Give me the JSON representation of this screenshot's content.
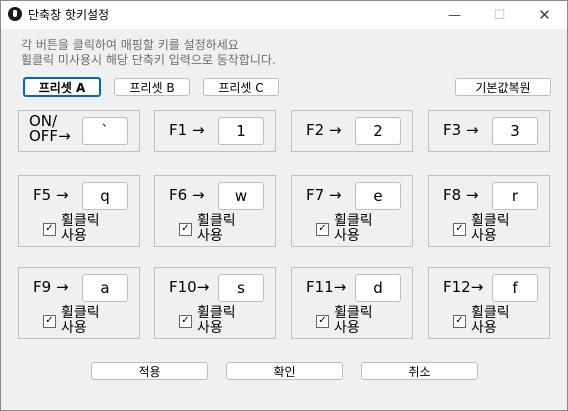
{
  "window": {
    "title": "단축창 핫키설정",
    "minimize_glyph": "—",
    "maximize_glyph": "☐",
    "close_glyph": "✕",
    "app_icon": "app-logo-icon"
  },
  "description": {
    "line1": "각 버튼을 클릭하여 매핑할 키를 설정하세요",
    "line2": "휠클릭 미사용시 해당 단축키 입력으로 동작합니다."
  },
  "presets": {
    "items": [
      {
        "label": "프리셋 A",
        "selected": true
      },
      {
        "label": "프리셋 B",
        "selected": false
      },
      {
        "label": "프리셋 C",
        "selected": false
      }
    ],
    "reset_label": "기본값복원"
  },
  "hotkeys": [
    {
      "label": "ON/\nOFF→",
      "key": "`",
      "has_wheel": false
    },
    {
      "label": "F1 →",
      "key": "1",
      "has_wheel": false
    },
    {
      "label": "F2 →",
      "key": "2",
      "has_wheel": false
    },
    {
      "label": "F3 →",
      "key": "3",
      "has_wheel": false
    },
    {
      "label": "F5 →",
      "key": "q",
      "has_wheel": true,
      "wheel_label": "휠클릭\n사용",
      "wheel_checked": true
    },
    {
      "label": "F6 →",
      "key": "w",
      "has_wheel": true,
      "wheel_label": "휠클릭\n사용",
      "wheel_checked": true
    },
    {
      "label": "F7 →",
      "key": "e",
      "has_wheel": true,
      "wheel_label": "휠클릭\n사용",
      "wheel_checked": true
    },
    {
      "label": "F8 →",
      "key": "r",
      "has_wheel": true,
      "wheel_label": "휠클릭\n사용",
      "wheel_checked": true
    },
    {
      "label": "F9 →",
      "key": "a",
      "has_wheel": true,
      "wheel_label": "휠클릭\n사용",
      "wheel_checked": true
    },
    {
      "label": "F10→",
      "key": "s",
      "has_wheel": true,
      "wheel_label": "휠클릭\n사용",
      "wheel_checked": true
    },
    {
      "label": "F11→",
      "key": "d",
      "has_wheel": true,
      "wheel_label": "휠클릭\n사용",
      "wheel_checked": true
    },
    {
      "label": "F12→",
      "key": "f",
      "has_wheel": true,
      "wheel_label": "휠클릭\n사용",
      "wheel_checked": true
    }
  ],
  "actions": {
    "apply_label": "적용",
    "ok_label": "확인",
    "cancel_label": "취소"
  },
  "colors": {
    "accent": "#0067c0",
    "window_bg": "#f0f0f0"
  }
}
